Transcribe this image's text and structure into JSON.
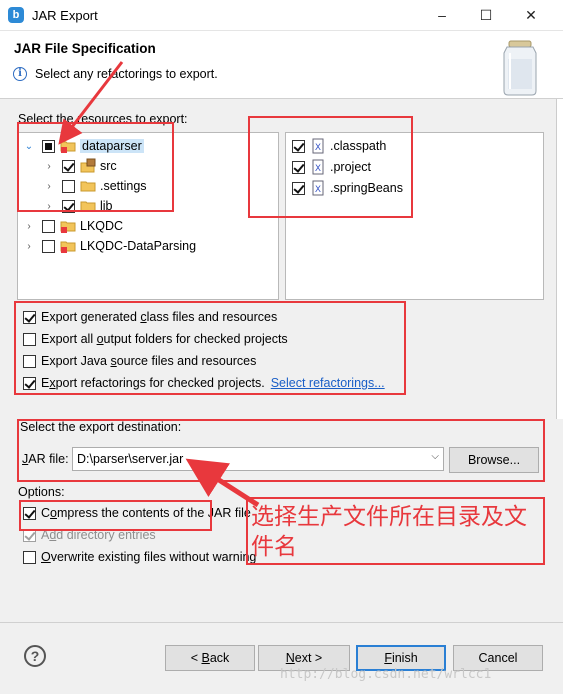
{
  "window": {
    "title": "JAR Export",
    "app_icon": "b",
    "minimize": "–",
    "maximize": "☐",
    "close": "✕"
  },
  "banner": {
    "title": "JAR File Specification",
    "message": "Select any refactorings to export."
  },
  "resources": {
    "label": "Select the resources to export:",
    "tree": [
      {
        "label": "dataparser",
        "state": "partial",
        "expanded": true,
        "level": 0,
        "icon": "java-project-icon",
        "selected": true
      },
      {
        "label": "src",
        "state": "checked",
        "expanded": false,
        "level": 1,
        "icon": "package-folder-icon"
      },
      {
        "label": ".settings",
        "state": "unchecked",
        "expanded": false,
        "level": 1,
        "icon": "folder-icon"
      },
      {
        "label": "lib",
        "state": "checked",
        "expanded": false,
        "level": 1,
        "icon": "folder-icon"
      },
      {
        "label": "LKQDC",
        "state": "unchecked",
        "expanded": false,
        "level": 0,
        "icon": "java-project-icon"
      },
      {
        "label": "LKQDC-DataParsing",
        "state": "unchecked",
        "expanded": false,
        "level": 0,
        "icon": "java-project-icon"
      }
    ],
    "files": [
      {
        "label": ".classpath",
        "state": "checked"
      },
      {
        "label": ".project",
        "state": "checked"
      },
      {
        "label": ".springBeans",
        "state": "checked"
      }
    ]
  },
  "export_options": [
    {
      "pre": "Export generated ",
      "u": "c",
      "post": "lass files and resources",
      "checked": true
    },
    {
      "pre": "Export all ",
      "u": "o",
      "post": "utput folders for checked projects",
      "checked": false
    },
    {
      "pre": "Export Java ",
      "u": "s",
      "post": "ource files and resources",
      "checked": false
    },
    {
      "pre": "E",
      "u": "x",
      "post": "port refactorings for checked projects.",
      "checked": true
    }
  ],
  "refactor_link": "Select refactorings...",
  "destination": {
    "label": "Select the export destination:",
    "jar_label": "JAR file:",
    "jar_value": "D:\\parser\\server.jar",
    "browse_label": "Browse..."
  },
  "options": {
    "label": "Options:",
    "items": [
      {
        "pre": "C",
        "u": "o",
        "post": "mpress the contents of the JAR file",
        "checked": true,
        "disabled": false
      },
      {
        "pre": "A",
        "u": "d",
        "post": "d directory entries",
        "checked": true,
        "disabled": true
      },
      {
        "pre": "",
        "u": "O",
        "post": "verwrite existing files without warning",
        "checked": false,
        "disabled": false
      }
    ]
  },
  "annotation": "选择生产文件所在目录及文件名",
  "footer": {
    "help": "?",
    "back": "< Back",
    "next": "Next >",
    "finish": "Finish",
    "cancel": "Cancel"
  },
  "watermark": "http://blog.csdn.net/wrlcc1",
  "colors": {
    "annotation_red": "#e8383d",
    "link_blue": "#1a5fc7",
    "focus_blue": "#2a7fd4",
    "selection": "#cce4f7"
  }
}
